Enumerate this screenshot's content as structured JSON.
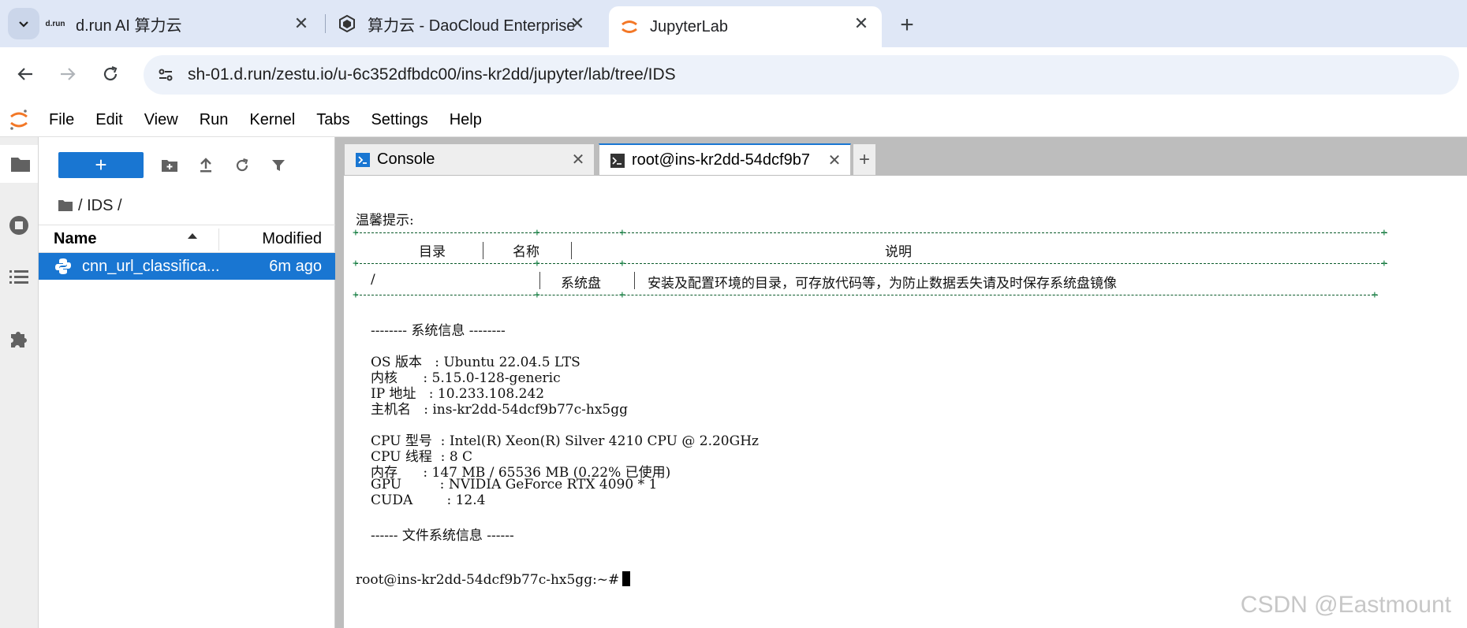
{
  "browser": {
    "tabs": [
      {
        "title": "d.run AI 算力云",
        "favicon": "drun-logo-icon",
        "favicon_text": "d.run"
      },
      {
        "title": "算力云 - DaoCloud Enterprise",
        "favicon": "daocloud-logo-icon"
      },
      {
        "title": "JupyterLab",
        "favicon": "jupyter-logo-icon"
      }
    ],
    "url": "sh-01.d.run/zestu.io/u-6c352dfbdc00/ins-kr2dd/jupyter/lab/tree/IDS"
  },
  "jupyter": {
    "menu": [
      "File",
      "Edit",
      "View",
      "Run",
      "Kernel",
      "Tabs",
      "Settings",
      "Help"
    ],
    "filebrowser": {
      "launcher_label": "+",
      "breadcrumb": "/ IDS /",
      "columns": {
        "name": "Name",
        "modified": "Modified"
      },
      "files": [
        {
          "name": "cnn_url_classifica...",
          "modified": "6m ago",
          "icon": "python-file-icon"
        }
      ]
    },
    "dock_tabs": [
      {
        "label": "Console",
        "icon": "console-icon"
      },
      {
        "label": "root@ins-kr2dd-54dcf9b7",
        "icon": "terminal-icon"
      }
    ],
    "add_tab_label": "+"
  },
  "terminal": {
    "tip_title": "温馨提示:",
    "table_headers": {
      "dir": "目录",
      "name": "名称",
      "desc": "说明"
    },
    "table_row": {
      "dir": "/",
      "name": "系统盘",
      "desc": "安装及配置环境的目录，可存放代码等，为防止数据丢失请及时保存系统盘镜像"
    },
    "sysinfo_header": "-------- 系统信息 --------",
    "sysinfo": [
      "OS 版本   : Ubuntu 22.04.5 LTS",
      "内核      : 5.15.0-128-generic",
      "IP 地址   : 10.233.108.242",
      "主机名   : ins-kr2dd-54dcf9b77c-hx5gg"
    ],
    "hwinfo": [
      "CPU 型号  : Intel(R) Xeon(R) Silver 4210 CPU @ 2.20GHz",
      "CPU 线程  : 8 C",
      "内存      : 147 MB / 65536 MB (0.22% 已使用)",
      "GPU         : NVIDIA GeForce RTX 4090 * 1",
      "CUDA        : 12.4"
    ],
    "fs_header": "------ 文件系统信息 ------",
    "prompt": "root@ins-kr2dd-54dcf9b77c-hx5gg:~#"
  },
  "watermark": "CSDN @Eastmount",
  "colors": {
    "accent": "#1976d2",
    "tabstrip": "#dfe7f6",
    "omnibox": "#edf2fa",
    "jupyter_orange": "#f37726"
  }
}
